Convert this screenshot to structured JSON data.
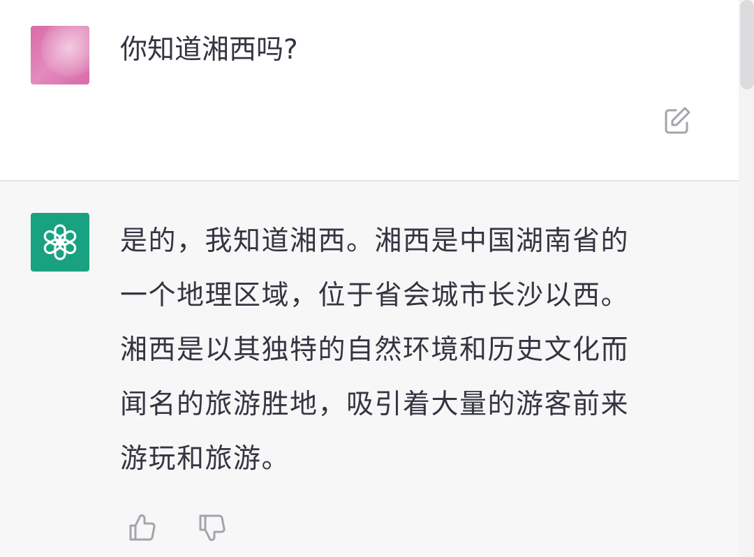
{
  "conversation": {
    "user_message": {
      "avatar": "user-avatar",
      "text": "你知道湘西吗?",
      "edit_icon": "edit-icon"
    },
    "assistant_message": {
      "avatar": "openai-logo-icon",
      "lines": [
        "是的，我知道湘西。湘西是中国湖南省的",
        "一个地理区域，位于省会城市长沙以西。",
        "湘西是以其独特的自然环境和历史文化而",
        "闻名的旅游胜地，吸引着大量的游客前来",
        "游玩和旅游。"
      ],
      "feedback_icons": [
        "thumbs-up-icon",
        "thumbs-down-icon"
      ]
    }
  },
  "colors": {
    "assistant_avatar_bg": "#19a27f",
    "assistant_bg": "#f7f7f8",
    "user_avatar_pink": "#d96aa7",
    "text": "#343541",
    "icon": "#a3a3ac"
  }
}
